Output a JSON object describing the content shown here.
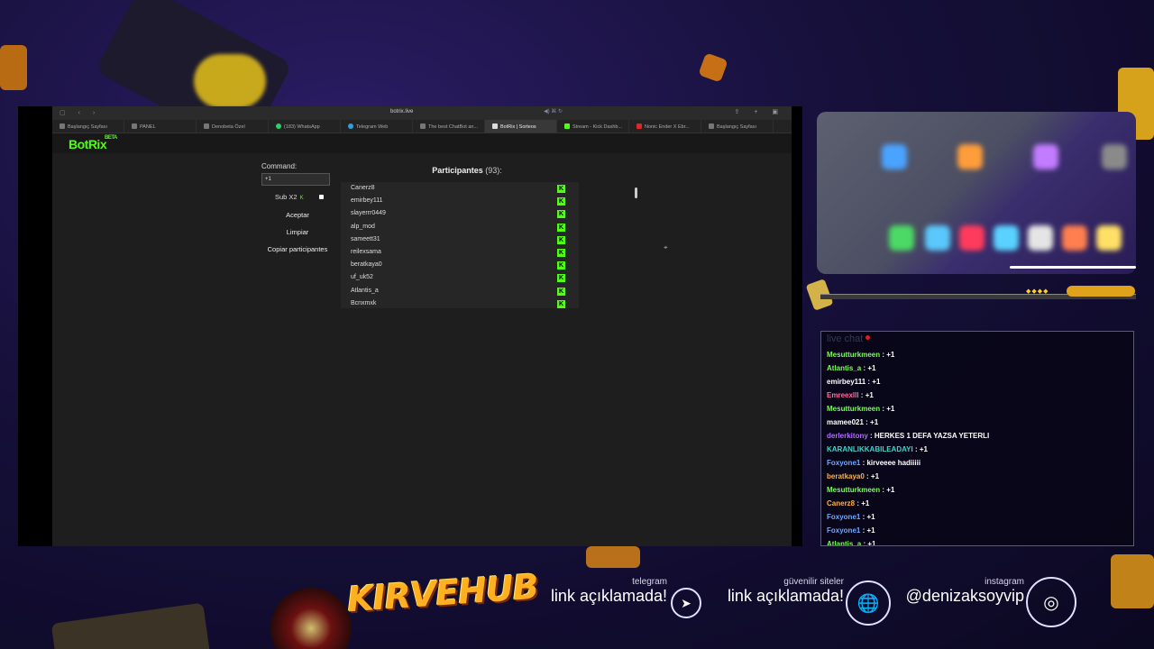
{
  "browser": {
    "url": "botrix.live",
    "tabs": [
      {
        "label": "Başlangıç Sayfası",
        "icon": "star-icon"
      },
      {
        "label": "PANEL",
        "icon": "page-icon"
      },
      {
        "label": "Denobeta Özel",
        "icon": "page-icon"
      },
      {
        "label": "(183) WhatsApp",
        "icon": "whatsapp-icon"
      },
      {
        "label": "Telegram Web",
        "icon": "telegram-icon"
      },
      {
        "label": "The best ChatBot an...",
        "icon": "page-icon"
      },
      {
        "label": "BotRix | Sorteos",
        "icon": "botrix-icon",
        "active": true
      },
      {
        "label": "Stream - Kick Dashb...",
        "icon": "kick-icon"
      },
      {
        "label": "Nonic Ender X Ebr...",
        "icon": "youtube-icon"
      },
      {
        "label": "Başlangıç Sayfası",
        "icon": "star-icon"
      }
    ]
  },
  "app": {
    "logo": "BotRix",
    "logo_badge": "BETA",
    "command_label": "Command:",
    "command_value": "+1",
    "sub_label": "Sub X2",
    "sub_mark": "K",
    "accept_label": "Aceptar",
    "clear_label": "Limpiar",
    "copy_label": "Copiar participantes",
    "participants_title": "Participantes",
    "participants_count": "(93):",
    "participants": [
      "Canerz8",
      "emirbey111",
      "slayerrr0449",
      "alp_mod",
      "sameett31",
      "reilexsama",
      "beratkaya0",
      "uf_uk52",
      "Atlantis_a",
      "Bcnxmxk"
    ],
    "platform_mark": "K"
  },
  "chat": {
    "title": "live chat",
    "messages": [
      {
        "user": "Mesutturkmeen",
        "text": "+1",
        "color": "#7cfc5a"
      },
      {
        "user": "Atlantis_a",
        "text": "+1",
        "color": "#7cfc5a"
      },
      {
        "user": "emirbey111",
        "text": "+1",
        "color": "#ffffff"
      },
      {
        "user": "Emreexlll",
        "text": "+1",
        "color": "#ff6b9d"
      },
      {
        "user": "Mesutturkmeen",
        "text": "+1",
        "color": "#7cfc5a"
      },
      {
        "user": "mamee021",
        "text": "+1",
        "color": "#ffffff"
      },
      {
        "user": "derlerkitony",
        "text": "HERKES 1 DEFA YAZSA YETERLI",
        "color": "#b16cff"
      },
      {
        "user": "KARANLIKKABILEADAYI",
        "text": "+1",
        "color": "#3ed6c8"
      },
      {
        "user": "Foxyone1",
        "text": "kirveeee hadiiiii",
        "color": "#6fa8ff"
      },
      {
        "user": "beratkaya0",
        "text": "+1",
        "color": "#ffb347"
      },
      {
        "user": "Mesutturkmeen",
        "text": "+1",
        "color": "#7cfc5a"
      },
      {
        "user": "Canerz8",
        "text": "+1",
        "color": "#ffb347"
      },
      {
        "user": "Foxyone1",
        "text": "+1",
        "color": "#6fa8ff"
      },
      {
        "user": "Foxyone1",
        "text": "+1",
        "color": "#6fa8ff"
      },
      {
        "user": "Atlantis_a",
        "text": "+1",
        "color": "#7cfc5a"
      }
    ]
  },
  "brand": "KIRVEHUB",
  "social": {
    "telegram": {
      "caption": "telegram",
      "value": "link açıklamada!",
      "icon": "telegram-icon"
    },
    "sites": {
      "caption": "güvenilir siteler",
      "value": "link açıklamada!",
      "icon": "globe-icon"
    },
    "instagram": {
      "caption": "instagram",
      "value": "@denizaksoyvip",
      "icon": "instagram-icon"
    }
  }
}
